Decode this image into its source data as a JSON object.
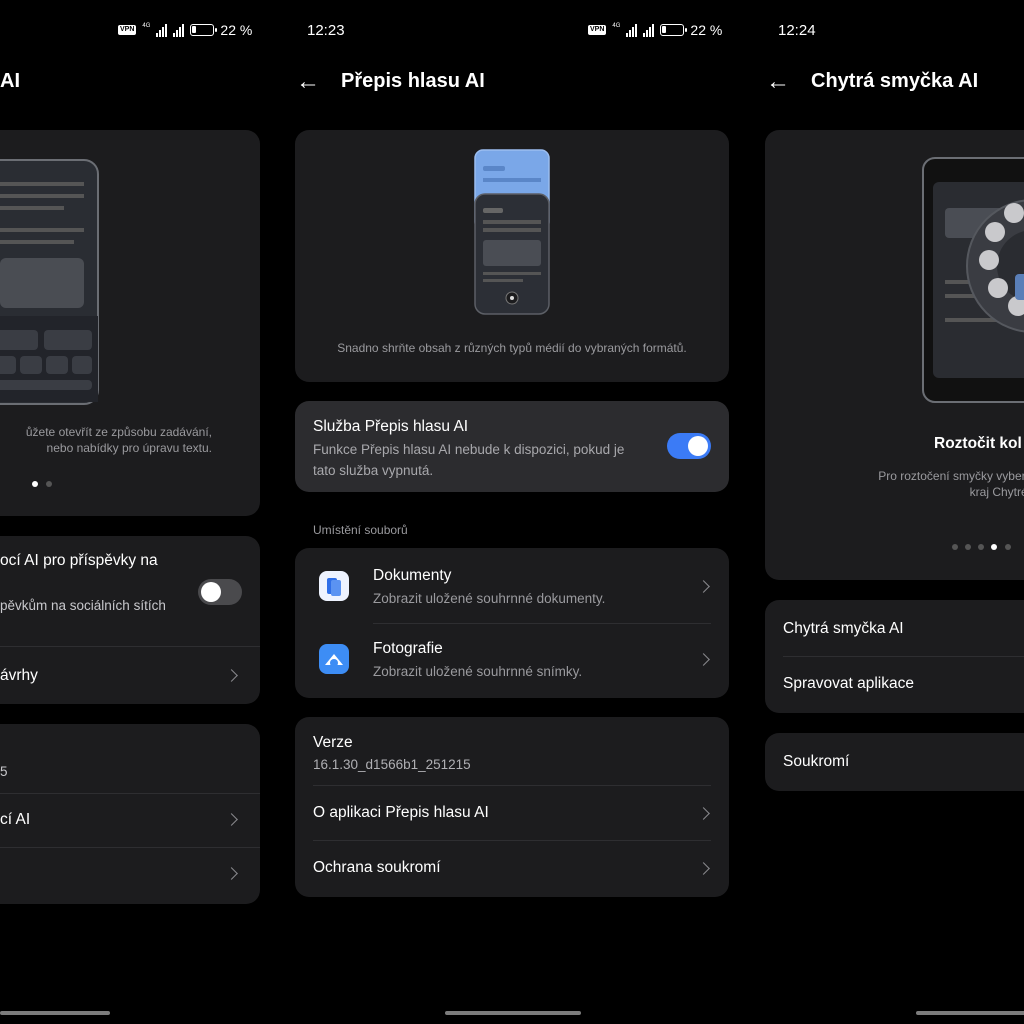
{
  "screen1": {
    "status": {
      "vpn": "VPN",
      "gen": "4G",
      "battery": "22 %"
    },
    "title": "AI",
    "hero_desc_line1": "ůžete otevřít ze způsobu zadávání,",
    "hero_desc_line2": "nebo nabídky pro úpravu textu.",
    "toggle_row_title": "ocí AI pro příspěvky na",
    "toggle_row_sub": "pěvkům na sociálních sítích",
    "toggle_on": false,
    "row_navrhy": "ávrhy",
    "row_version_partial": "5",
    "row_ai_partial": "cí AI"
  },
  "screen2": {
    "time": "12:23",
    "status": {
      "vpn": "VPN",
      "gen": "4G",
      "battery": "22 %"
    },
    "title": "Přepis hlasu AI",
    "hero_desc": "Snadno shrňte obsah z různých typů médií do vybraných formátů.",
    "service": {
      "title": "Služba Přepis hlasu AI",
      "desc_line1": "Funkce Přepis hlasu AI nebude k dispozici, pokud je",
      "desc_line2": "tato služba vypnutá.",
      "enabled": true
    },
    "section_label": "Umístění souborů",
    "files": [
      {
        "title": "Dokumenty",
        "sub": "Zobrazit uložené souhrnné dokumenty.",
        "icon": "documents-icon"
      },
      {
        "title": "Fotografie",
        "sub": "Zobrazit uložené souhrnné snímky.",
        "icon": "photos-icon"
      }
    ],
    "version_label": "Verze",
    "version_value": "16.1.30_d1566b1_251215",
    "about": "O aplikaci Přepis hlasu AI",
    "privacy": "Ochrana soukromí"
  },
  "screen3": {
    "time": "12:24",
    "title": "Chytrá smyčka AI",
    "hero_title": "Roztočit kol",
    "hero_desc_line1": "Pro roztočení smyčky vyberte obsa",
    "hero_desc_line2": "kraj Chytré smyčk",
    "row_loop": "Chytrá smyčka AI",
    "row_apps": "Spravovat aplikace",
    "row_privacy": "Soukromí"
  },
  "colors": {
    "card": "#1c1c1e",
    "accent": "#3b7bf6",
    "secondary_text": "#9a9a9e"
  }
}
